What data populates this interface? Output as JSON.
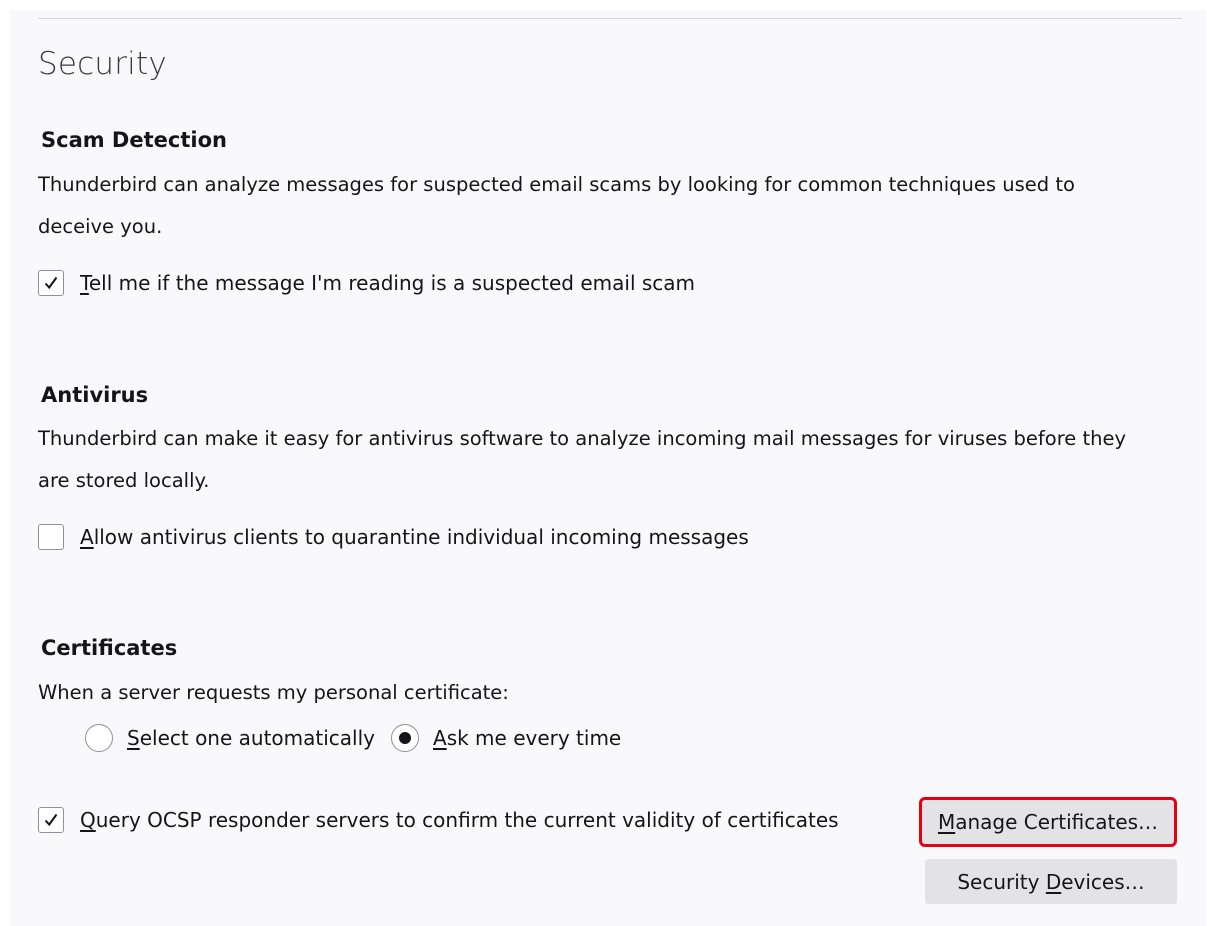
{
  "page": {
    "title": "Security"
  },
  "scam": {
    "heading": "Scam Detection",
    "desc_line1": "Thunderbird can analyze messages for suspected email scams by looking for common techniques used to",
    "desc_line2": "deceive you.",
    "checkbox": {
      "accel": "T",
      "rest": "ell me if the message I'm reading is a suspected email scam",
      "checked": true
    }
  },
  "antivirus": {
    "heading": "Antivirus",
    "desc_line1": "Thunderbird can make it easy for antivirus software to analyze incoming mail messages for viruses before they",
    "desc_line2": "are stored locally.",
    "checkbox": {
      "accel": "A",
      "rest": "llow antivirus clients to quarantine individual incoming messages",
      "checked": false
    }
  },
  "certificates": {
    "heading": "Certificates",
    "prompt": "When a server requests my personal certificate:",
    "radio_auto": {
      "accel": "S",
      "rest": "elect one automatically",
      "selected": false
    },
    "radio_ask": {
      "accel": "A",
      "rest": "sk me every time",
      "selected": true
    },
    "ocsp_checkbox": {
      "accel": "Q",
      "rest": "uery OCSP responder servers to confirm the current validity of certificates",
      "checked": true
    },
    "manage_button": {
      "accel": "M",
      "rest": "anage Certificates…"
    },
    "devices_button": {
      "pre": "Security ",
      "accel": "D",
      "rest": "evices…"
    }
  },
  "colors": {
    "highlight_outline": "#e3000f",
    "button_bg": "#e3e3e6",
    "pane_bg": "#f9f9fb"
  },
  "icons": {
    "checkmark": "checkmark-icon",
    "radio_dot": "radio-dot-icon"
  }
}
